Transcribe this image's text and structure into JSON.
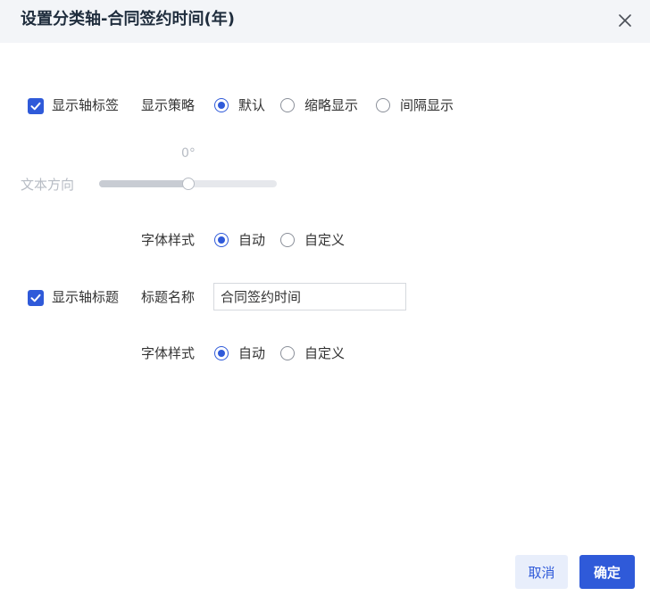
{
  "dialog": {
    "title": "设置分类轴-合同签约时间(年)"
  },
  "axis_label": {
    "checkbox_label": "显示轴标签",
    "strategy_label": "显示策略",
    "strategy_options": [
      "默认",
      "缩略显示",
      "间隔显示"
    ],
    "strategy_selected": "默认",
    "text_direction_label": "文本方向",
    "text_direction_value": "0°",
    "text_direction_level": 0.5,
    "font_style_label": "字体样式",
    "font_style_options": [
      "自动",
      "自定义"
    ],
    "font_style_selected": "自动"
  },
  "axis_title": {
    "checkbox_label": "显示轴标题",
    "name_label": "标题名称",
    "name_value": "合同签约时间",
    "font_style_label": "字体样式",
    "font_style_options": [
      "自动",
      "自定义"
    ],
    "font_style_selected": "自动"
  },
  "footer": {
    "cancel_label": "取消",
    "ok_label": "确定"
  },
  "colors": {
    "accent": "#2f5ad9",
    "header_bg": "#f3f5f8",
    "disabled_text": "#b7bcc4"
  }
}
